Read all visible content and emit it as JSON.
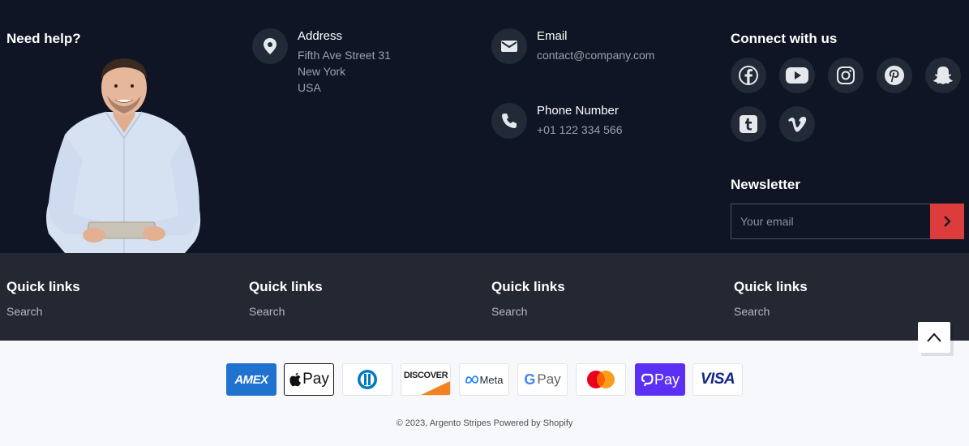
{
  "need_help": {
    "title": "Need help?"
  },
  "address": {
    "title": "Address",
    "lines": [
      "Fifth Ave Street 31",
      "New York",
      "USA"
    ],
    "icon": "location-pin-icon"
  },
  "email": {
    "title": "Email",
    "value": "contact@company.com",
    "icon": "envelope-icon"
  },
  "phone": {
    "title": "Phone Number",
    "value": "+01 122 334 566",
    "icon": "phone-icon"
  },
  "connect": {
    "title": "Connect with us",
    "icons": [
      "facebook-icon",
      "youtube-icon",
      "instagram-icon",
      "pinterest-icon",
      "snapchat-icon",
      "tumblr-icon",
      "vimeo-icon"
    ]
  },
  "newsletter": {
    "title": "Newsletter",
    "placeholder": "Your email",
    "submit_icon": "chevron-right-icon",
    "accent": "#dc3c3c"
  },
  "quick_links": [
    {
      "title": "Quick links",
      "link": "Search"
    },
    {
      "title": "Quick links",
      "link": "Search"
    },
    {
      "title": "Quick links",
      "link": "Search"
    },
    {
      "title": "Quick links",
      "link": "Search"
    }
  ],
  "payments": [
    {
      "name": "amex",
      "label": "AMEX"
    },
    {
      "name": "apple-pay",
      "label": "Pay"
    },
    {
      "name": "diners-club",
      "label": ""
    },
    {
      "name": "discover",
      "label": "DISCOVER"
    },
    {
      "name": "meta-pay",
      "label": "Meta"
    },
    {
      "name": "google-pay",
      "label": "Pay"
    },
    {
      "name": "mastercard",
      "label": ""
    },
    {
      "name": "shop-pay",
      "label": "Pay"
    },
    {
      "name": "visa",
      "label": "VISA"
    }
  ],
  "copyright": "© 2023, Argento Stripes Powered by Shopify",
  "colors": {
    "dark_bg": "#0f1524",
    "links_bg": "#232833",
    "icon_circle": "#232a37",
    "page_bg": "#f7f8fb"
  }
}
